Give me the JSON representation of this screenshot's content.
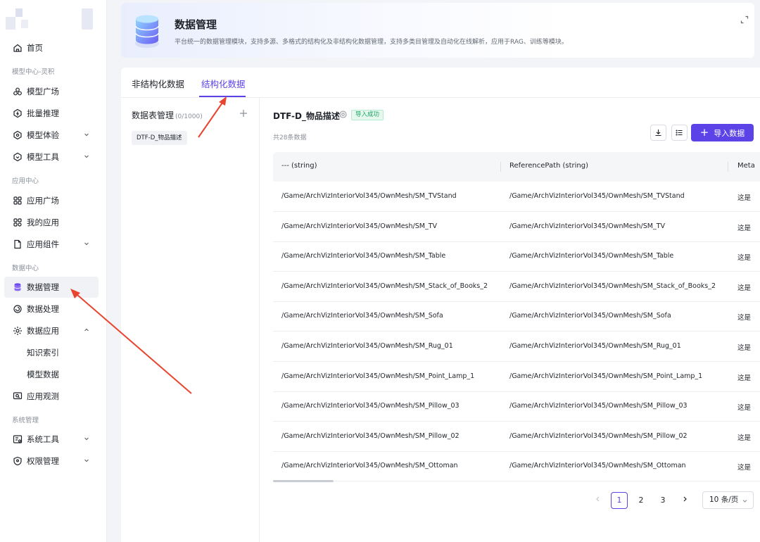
{
  "sidebar": {
    "nav": [
      {
        "label": "首页",
        "icon": "home-icon"
      },
      {
        "section": "模型中心-灵积"
      },
      {
        "label": "模型广场",
        "icon": "model-square-icon"
      },
      {
        "label": "批量推理",
        "icon": "batch-inference-icon"
      },
      {
        "label": "模型体验",
        "icon": "model-experience-icon",
        "chevron": "down"
      },
      {
        "label": "模型工具",
        "icon": "model-tools-icon",
        "chevron": "down"
      },
      {
        "section": "应用中心"
      },
      {
        "label": "应用广场",
        "icon": "app-square-icon"
      },
      {
        "label": "我的应用",
        "icon": "my-apps-icon"
      },
      {
        "label": "应用组件",
        "icon": "app-components-icon",
        "chevron": "down"
      },
      {
        "section": "数据中心"
      },
      {
        "label": "数据管理",
        "icon": "database-icon",
        "active": true
      },
      {
        "label": "数据处理",
        "icon": "data-processing-icon"
      },
      {
        "label": "数据应用",
        "icon": "data-application-icon",
        "chevron": "up"
      },
      {
        "label": "知识索引"
      },
      {
        "label": "模型数据"
      },
      {
        "label": "应用观测",
        "icon": "app-observation-icon"
      },
      {
        "section": "系统管理"
      },
      {
        "label": "系统工具",
        "icon": "system-tools-icon",
        "chevron": "down"
      },
      {
        "label": "权限管理",
        "icon": "permission-icon",
        "chevron": "down"
      }
    ]
  },
  "header": {
    "title": "数据管理",
    "description": "平台统一的数据管理模块，支持多源、多格式的结构化及非结构化数据管理，支持多类目管理及自动化在线解析，应用于RAG、训练等模块。"
  },
  "tabs": [
    {
      "label": "非结构化数据",
      "active": false
    },
    {
      "label": "结构化数据",
      "active": true
    }
  ],
  "left_pane": {
    "title": "数据表管理",
    "count": "(0/1000)",
    "items": [
      "DTF-D_物品描述"
    ]
  },
  "right_pane": {
    "table_name": "DTF-D_物品描述",
    "status_badge": "导入成功",
    "total": "共28条数据",
    "import_button": "导入数据",
    "columns": [
      "--- (string)",
      "ReferencePath (string)",
      "Meta"
    ],
    "rows": [
      [
        "/Game/ArchVizInteriorVol345/OwnMesh/SM_TVStand",
        "/Game/ArchVizInteriorVol345/OwnMesh/SM_TVStand",
        "这是"
      ],
      [
        "/Game/ArchVizInteriorVol345/OwnMesh/SM_TV",
        "/Game/ArchVizInteriorVol345/OwnMesh/SM_TV",
        "这是"
      ],
      [
        "/Game/ArchVizInteriorVol345/OwnMesh/SM_Table",
        "/Game/ArchVizInteriorVol345/OwnMesh/SM_Table",
        "这是"
      ],
      [
        "/Game/ArchVizInteriorVol345/OwnMesh/SM_Stack_of_Books_2",
        "/Game/ArchVizInteriorVol345/OwnMesh/SM_Stack_of_Books_2",
        "这是"
      ],
      [
        "/Game/ArchVizInteriorVol345/OwnMesh/SM_Sofa",
        "/Game/ArchVizInteriorVol345/OwnMesh/SM_Sofa",
        "这是"
      ],
      [
        "/Game/ArchVizInteriorVol345/OwnMesh/SM_Rug_01",
        "/Game/ArchVizInteriorVol345/OwnMesh/SM_Rug_01",
        "这是"
      ],
      [
        "/Game/ArchVizInteriorVol345/OwnMesh/SM_Point_Lamp_1",
        "/Game/ArchVizInteriorVol345/OwnMesh/SM_Point_Lamp_1",
        "这是"
      ],
      [
        "/Game/ArchVizInteriorVol345/OwnMesh/SM_Pillow_03",
        "/Game/ArchVizInteriorVol345/OwnMesh/SM_Pillow_03",
        "这是"
      ],
      [
        "/Game/ArchVizInteriorVol345/OwnMesh/SM_Pillow_02",
        "/Game/ArchVizInteriorVol345/OwnMesh/SM_Pillow_02",
        "这是"
      ],
      [
        "/Game/ArchVizInteriorVol345/OwnMesh/SM_Ottoman",
        "/Game/ArchVizInteriorVol345/OwnMesh/SM_Ottoman",
        "这是"
      ]
    ],
    "pagination": {
      "pages": [
        "1",
        "2",
        "3"
      ],
      "current": "1",
      "page_size": "10 条/页"
    }
  },
  "colors": {
    "accent": "#5b43e8",
    "success": "#17a862",
    "annotation_arrow": "#e8442e"
  }
}
